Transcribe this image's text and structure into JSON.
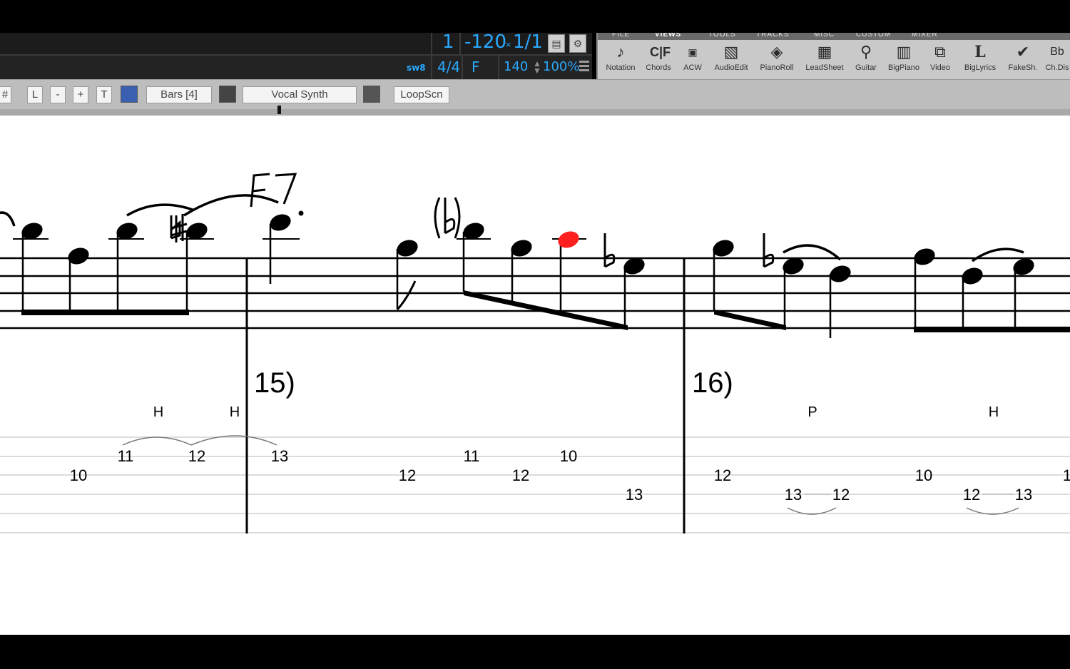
{
  "display": {
    "bar": "1",
    "tempo_offset": "-120",
    "beat": "1/1",
    "swing_label": "sw8",
    "time_signature": "4/4",
    "key": "F",
    "tempo": "140",
    "volume": "100%"
  },
  "tabs": [
    "FILE",
    "VIEWS",
    "TOOLS",
    "TRACKS",
    "MISC",
    "CUSTOM",
    "MIXER"
  ],
  "tools": [
    "Notation",
    "Chords",
    "ACW",
    "AudioEdit",
    "PianoRoll",
    "LeadSheet",
    "Guitar",
    "BigPiano",
    "Video",
    "BigLyrics",
    "FakeSh.",
    "Ch.Dis"
  ],
  "subbar": {
    "hash": "#",
    "l": "L",
    "minus": "-",
    "plus": "+",
    "t": "T",
    "bars": "Bars [4]",
    "vocal_synth": "Vocal Synth",
    "loop_scn": "LoopScn"
  },
  "score": {
    "chord_symbol": "F7",
    "flat_parenthetical": "(b)",
    "measure_numbers": [
      "15)",
      "16)"
    ],
    "technique_marks": [
      "H",
      "H",
      "P",
      "H"
    ],
    "tab_numbers": [
      "10",
      "11",
      "12",
      "13",
      "12",
      "11",
      "12",
      "10",
      "13",
      "12",
      "13",
      "12",
      "10",
      "12",
      "13",
      "1"
    ]
  },
  "colors": {
    "lcd_text": "#2aa9ff",
    "highlight_note": "#ff1f1f",
    "staff": "#000000"
  }
}
